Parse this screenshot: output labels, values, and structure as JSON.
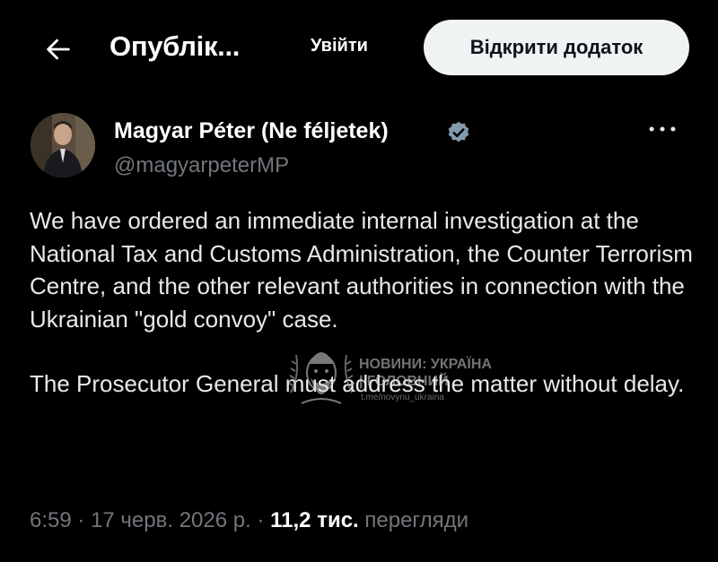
{
  "header": {
    "title": "Опублік...",
    "login_label": "Увійти",
    "open_app_label": "Відкрити додаток"
  },
  "author": {
    "name": "Magyar Péter (Ne féljetek)",
    "handle": "@magyarpeterMP",
    "verified_color": "#829aab"
  },
  "tweet": {
    "paragraph1": "We have ordered an immediate internal investigation at the National Tax and Customs Administration, the Counter Terrorism Centre, and the other relevant authorities in connection with the Ukrainian \"gold convoy\" case.",
    "paragraph2": "The Prosecutor General must address the matter without delay."
  },
  "watermark": {
    "line1": "НОВИНИ: УКРАЇНА",
    "line2": "| ГОЛОВНИЙ",
    "line3": "t.me/novynu_ukraina"
  },
  "meta": {
    "time": "6:59",
    "separator": "·",
    "date": "17 черв. 2026 р.",
    "views_count": "11,2 тис.",
    "views_label": "перегляди"
  },
  "icons": {
    "back": "arrow-left-icon",
    "verified": "verified-badge-icon",
    "more": "more-horizontal-icon"
  }
}
